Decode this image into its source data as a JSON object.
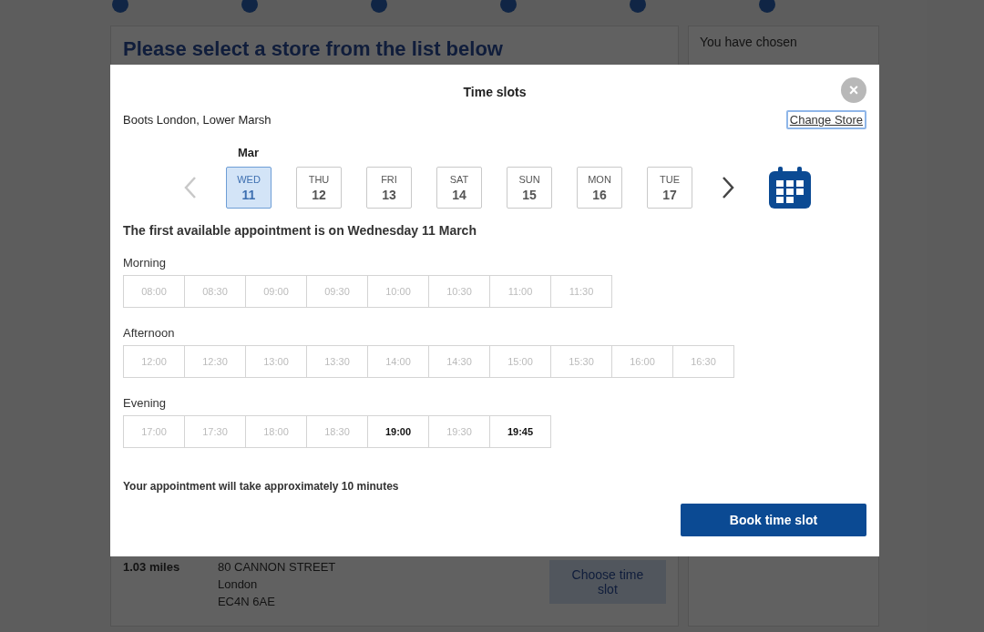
{
  "page": {
    "heading": "Please select a store from the list below",
    "sidebar_title": "You have chosen",
    "store": {
      "distance": "1.03 miles",
      "address": [
        "80 CANNON STREET",
        "London",
        "EC4N 6AE"
      ],
      "button": "Choose time slot"
    }
  },
  "modal": {
    "title": "Time slots",
    "close": "×",
    "store_name": "Boots London, Lower Marsh",
    "change_store": "Change Store",
    "month": "Mar",
    "prev_disabled": true,
    "days": [
      {
        "weekday": "WED",
        "date": "11",
        "selected": true
      },
      {
        "weekday": "THU",
        "date": "12",
        "selected": false
      },
      {
        "weekday": "FRI",
        "date": "13",
        "selected": false
      },
      {
        "weekday": "SAT",
        "date": "14",
        "selected": false
      },
      {
        "weekday": "SUN",
        "date": "15",
        "selected": false
      },
      {
        "weekday": "MON",
        "date": "16",
        "selected": false
      },
      {
        "weekday": "TUE",
        "date": "17",
        "selected": false
      }
    ],
    "first_available": "The first available appointment is on Wednesday 11 March",
    "periods": [
      {
        "label": "Morning",
        "slots": [
          {
            "time": "08:00",
            "available": false
          },
          {
            "time": "08:30",
            "available": false
          },
          {
            "time": "09:00",
            "available": false
          },
          {
            "time": "09:30",
            "available": false
          },
          {
            "time": "10:00",
            "available": false
          },
          {
            "time": "10:30",
            "available": false
          },
          {
            "time": "11:00",
            "available": false
          },
          {
            "time": "11:30",
            "available": false
          }
        ]
      },
      {
        "label": "Afternoon",
        "slots": [
          {
            "time": "12:00",
            "available": false
          },
          {
            "time": "12:30",
            "available": false
          },
          {
            "time": "13:00",
            "available": false
          },
          {
            "time": "13:30",
            "available": false
          },
          {
            "time": "14:00",
            "available": false
          },
          {
            "time": "14:30",
            "available": false
          },
          {
            "time": "15:00",
            "available": false
          },
          {
            "time": "15:30",
            "available": false
          },
          {
            "time": "16:00",
            "available": false
          },
          {
            "time": "16:30",
            "available": false
          }
        ]
      },
      {
        "label": "Evening",
        "slots": [
          {
            "time": "17:00",
            "available": false
          },
          {
            "time": "17:30",
            "available": false
          },
          {
            "time": "18:00",
            "available": false
          },
          {
            "time": "18:30",
            "available": false
          },
          {
            "time": "19:00",
            "available": true
          },
          {
            "time": "19:30",
            "available": false
          },
          {
            "time": "19:45",
            "available": true
          }
        ]
      }
    ],
    "duration_note": "Your appointment will take approximately 10 minutes",
    "book_button": "Book time slot"
  }
}
